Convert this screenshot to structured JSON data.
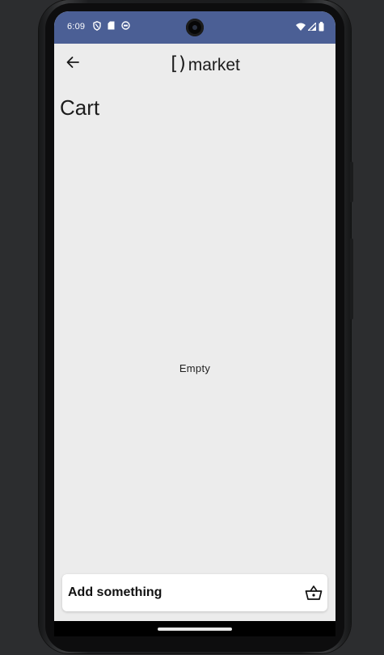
{
  "status_bar": {
    "time": "6:09",
    "left_icons": [
      "vpn-shield-icon",
      "sd-card-icon",
      "storage-icon"
    ],
    "right_icons": [
      "wifi-icon",
      "cell-signal-icon",
      "battery-icon"
    ],
    "color": "#4b5f95"
  },
  "app_bar": {
    "back_icon": "arrow-back-icon",
    "logo_mark": "[)",
    "logo_text": "market"
  },
  "page": {
    "title": "Cart",
    "empty_message": "Empty"
  },
  "bottom_action": {
    "label": "Add something",
    "icon": "basket-icon"
  },
  "colors": {
    "screen_background": "#ececec",
    "text": "#1c1c1c",
    "card": "#ffffff"
  }
}
